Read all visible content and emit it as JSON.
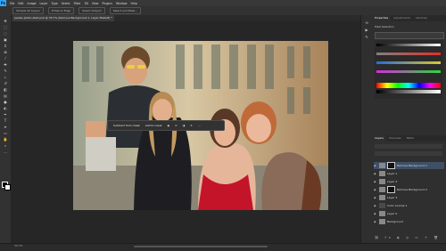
{
  "menu": [
    "File",
    "Edit",
    "Image",
    "Layer",
    "Type",
    "Select",
    "Filter",
    "3D",
    "View",
    "Plugins",
    "Window",
    "Help"
  ],
  "app_logo": "Ps",
  "options": [
    "Sample All Layers",
    "Enhance Edge",
    "Select Subject",
    "Select and Mask..."
  ],
  "doc_tab": "pexels-photo-start.psd @ 33.7% (Remove Background 1, Layer Mask/8) *",
  "context_bar": {
    "subtract": "Subtract from mask",
    "add": "Add to mask"
  },
  "status": "33.7%",
  "panels": {
    "top_tabs": [
      "Properties",
      "Adjustments",
      "Libraries"
    ],
    "prop_label": "Pixel Selection",
    "layer_tabs": [
      "Layers",
      "Channels",
      "Paths"
    ],
    "layers": [
      {
        "name": "Remove Background 1"
      },
      {
        "name": "Layer 1"
      },
      {
        "name": "Layer 2"
      },
      {
        "name": "Remove Background 2"
      },
      {
        "name": "Layer 3"
      },
      {
        "name": "Color Lookup 1"
      },
      {
        "name": "Layer 0"
      },
      {
        "name": "Background"
      }
    ]
  }
}
